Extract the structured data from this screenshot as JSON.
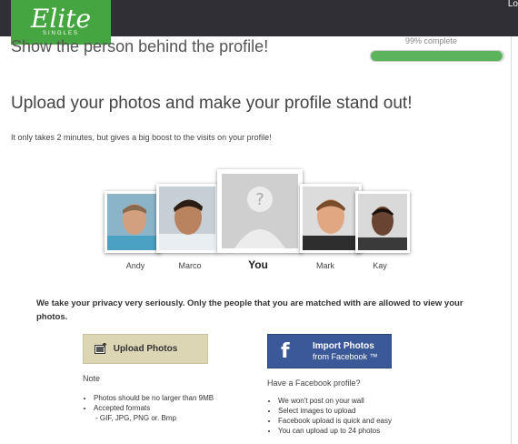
{
  "topbar": {
    "right_text": "Lo"
  },
  "logo": {
    "main": "Elite",
    "sub": "SINGLES"
  },
  "header": {
    "headline": "Show the person behind the profile!",
    "progress_text": "99% complete",
    "progress_fraction": 0.99
  },
  "main": {
    "title": "Upload your photos and make your profile stand out!",
    "subtitle": "It only takes 2 minutes, but gives a big boost to the visits on your profile!"
  },
  "photos": [
    {
      "name": "Andy"
    },
    {
      "name": "Marco"
    },
    {
      "name": "You"
    },
    {
      "name": "Mark"
    },
    {
      "name": "Kay"
    }
  ],
  "privacy_text": "We take your privacy very seriously. Only the people that you are matched with are allowed to view your photos.",
  "upload": {
    "button_label": "Upload Photos",
    "note_title": "Note",
    "notes": [
      "Photos should be no larger than 9MB",
      "Accepted formats"
    ],
    "formats": "- GIF, JPG, PNG or. Bmp"
  },
  "facebook": {
    "button_line1": "Import Photos",
    "button_line2": "from Facebook ™",
    "title": "Have a Facebook profile?",
    "items": [
      "We won't post on your wall",
      "Select images to upload",
      "Facebook upload is quick and easy",
      "You can upload up to 24 photos"
    ]
  },
  "colors": {
    "brand_green": "#45a540",
    "progress": "#5bb45b",
    "facebook_blue": "#3b5998",
    "upload_button": "#ddd6b5"
  }
}
